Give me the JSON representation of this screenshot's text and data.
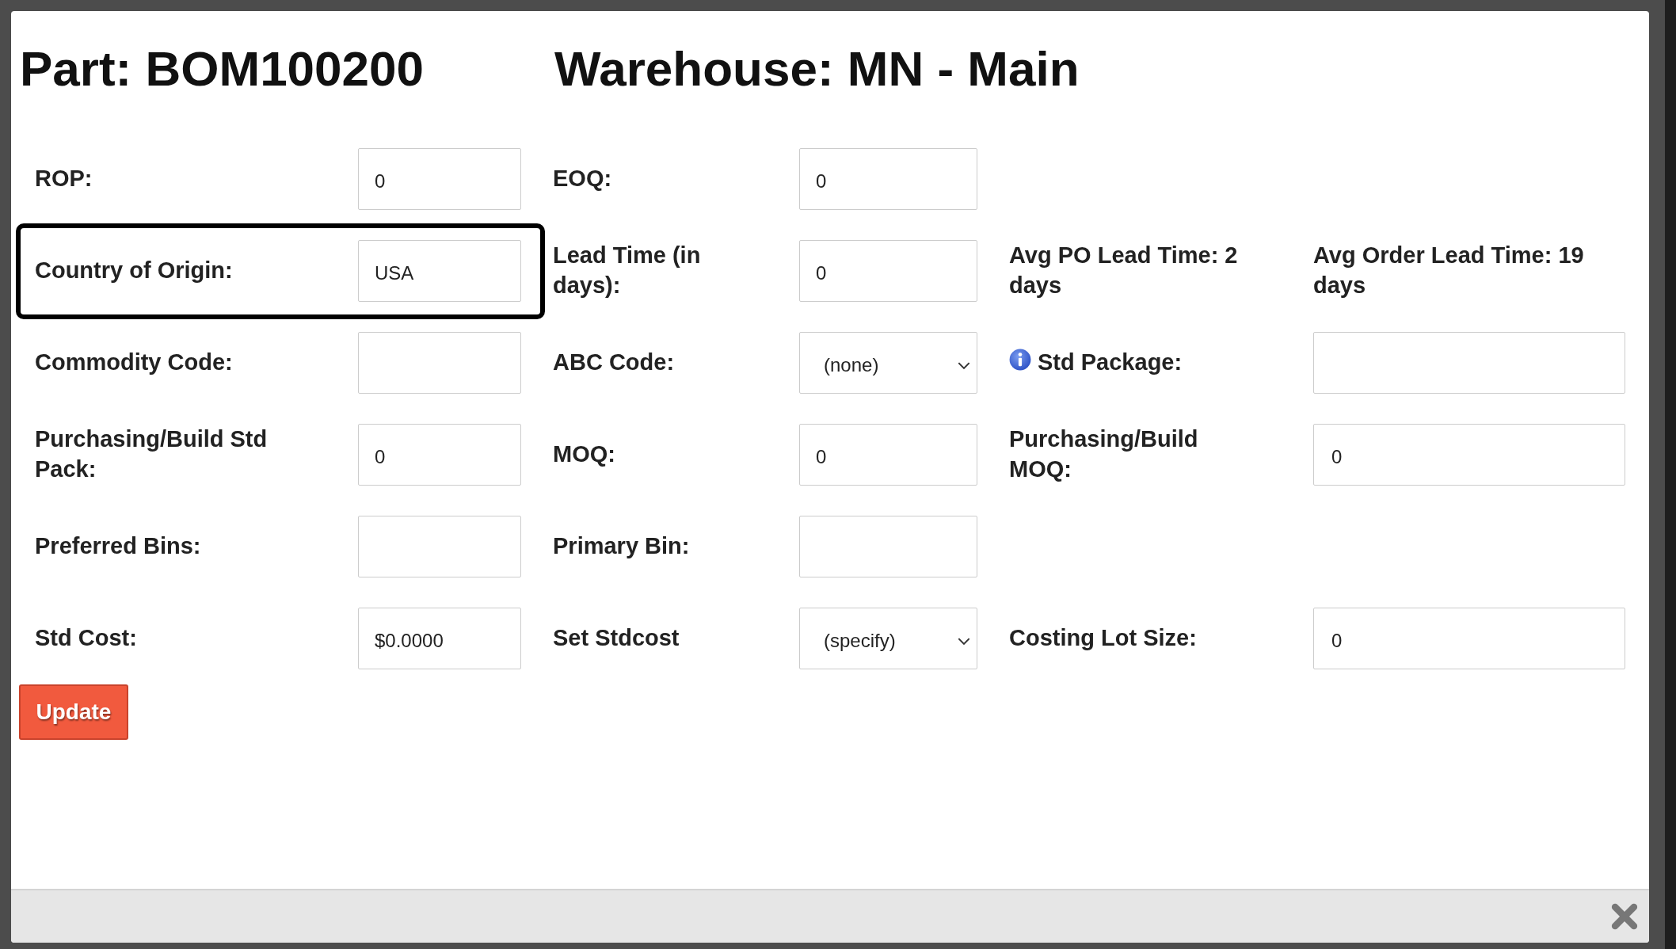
{
  "title": {
    "part": "Part: BOM100200",
    "warehouse": "Warehouse: MN - Main"
  },
  "rows": [
    {
      "fields": [
        {
          "kind": "input",
          "label": "ROP:",
          "value": "0",
          "highlighted": false
        },
        {
          "kind": "input",
          "label": "EOQ:",
          "value": "0"
        }
      ]
    },
    {
      "fields": [
        {
          "kind": "input",
          "label": "Country of Origin:",
          "value": "USA",
          "highlighted": true
        },
        {
          "kind": "input",
          "label": "Lead Time (in days):",
          "value": "0"
        },
        {
          "kind": "text",
          "label": "Avg PO Lead Time: 2 days"
        },
        {
          "kind": "text",
          "label": "Avg Order Lead Time: 19 days"
        }
      ]
    },
    {
      "fields": [
        {
          "kind": "input",
          "label": "Commodity Code:",
          "highlighted": false
        },
        {
          "kind": "select",
          "label": "ABC Code:",
          "value": "(none)"
        },
        {
          "kind": "input",
          "label": "Std Package:",
          "info_icon": true
        }
      ]
    },
    {
      "fields": [
        {
          "kind": "input",
          "label": "Purchasing/Build Std Pack:",
          "value": "0",
          "highlighted": false
        },
        {
          "kind": "input",
          "label": "MOQ:",
          "value": "0"
        },
        {
          "kind": "input",
          "label": "Purchasing/Build MOQ:",
          "value": "0"
        }
      ]
    },
    {
      "fields": [
        {
          "kind": "input",
          "label": "Preferred Bins:",
          "highlighted": false
        },
        {
          "kind": "input",
          "label": "Primary Bin:"
        }
      ]
    },
    {
      "fields": [
        {
          "kind": "input",
          "label": "Std Cost:",
          "value": "$0.0000",
          "highlighted": false
        },
        {
          "kind": "select",
          "label": "Set Stdcost",
          "value": "(specify)"
        },
        {
          "kind": "input",
          "label": "Costing Lot Size:",
          "value": "0"
        }
      ]
    }
  ],
  "update_button": "Update"
}
